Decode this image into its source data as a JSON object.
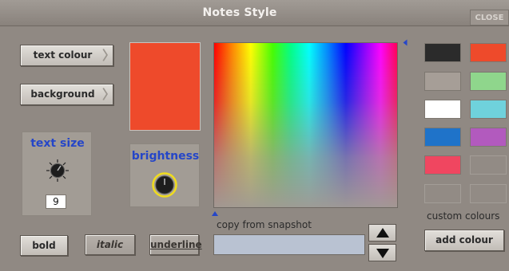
{
  "window": {
    "title": "Notes Style",
    "close_label": "CLOSE"
  },
  "buttons": {
    "text_colour": "text colour",
    "background": "background",
    "bold": "bold",
    "italic": "italic",
    "underline": "underline",
    "add_colour": "add colour"
  },
  "current_colour": "#ee4a2b",
  "text_size": {
    "label": "text size",
    "value": "9"
  },
  "brightness": {
    "label": "brightness"
  },
  "snapshot": {
    "label": "copy from snapshot",
    "value": ""
  },
  "custom_colours": {
    "label": "custom colours",
    "swatches": [
      "#2b2b2b",
      "#ee4a2b",
      "#a69e97",
      "#8fd68c",
      "#ffffff",
      "#6fd2dc",
      "#1f73c9",
      "#b25abe",
      "#f04660",
      "empty",
      "empty",
      "empty"
    ]
  }
}
